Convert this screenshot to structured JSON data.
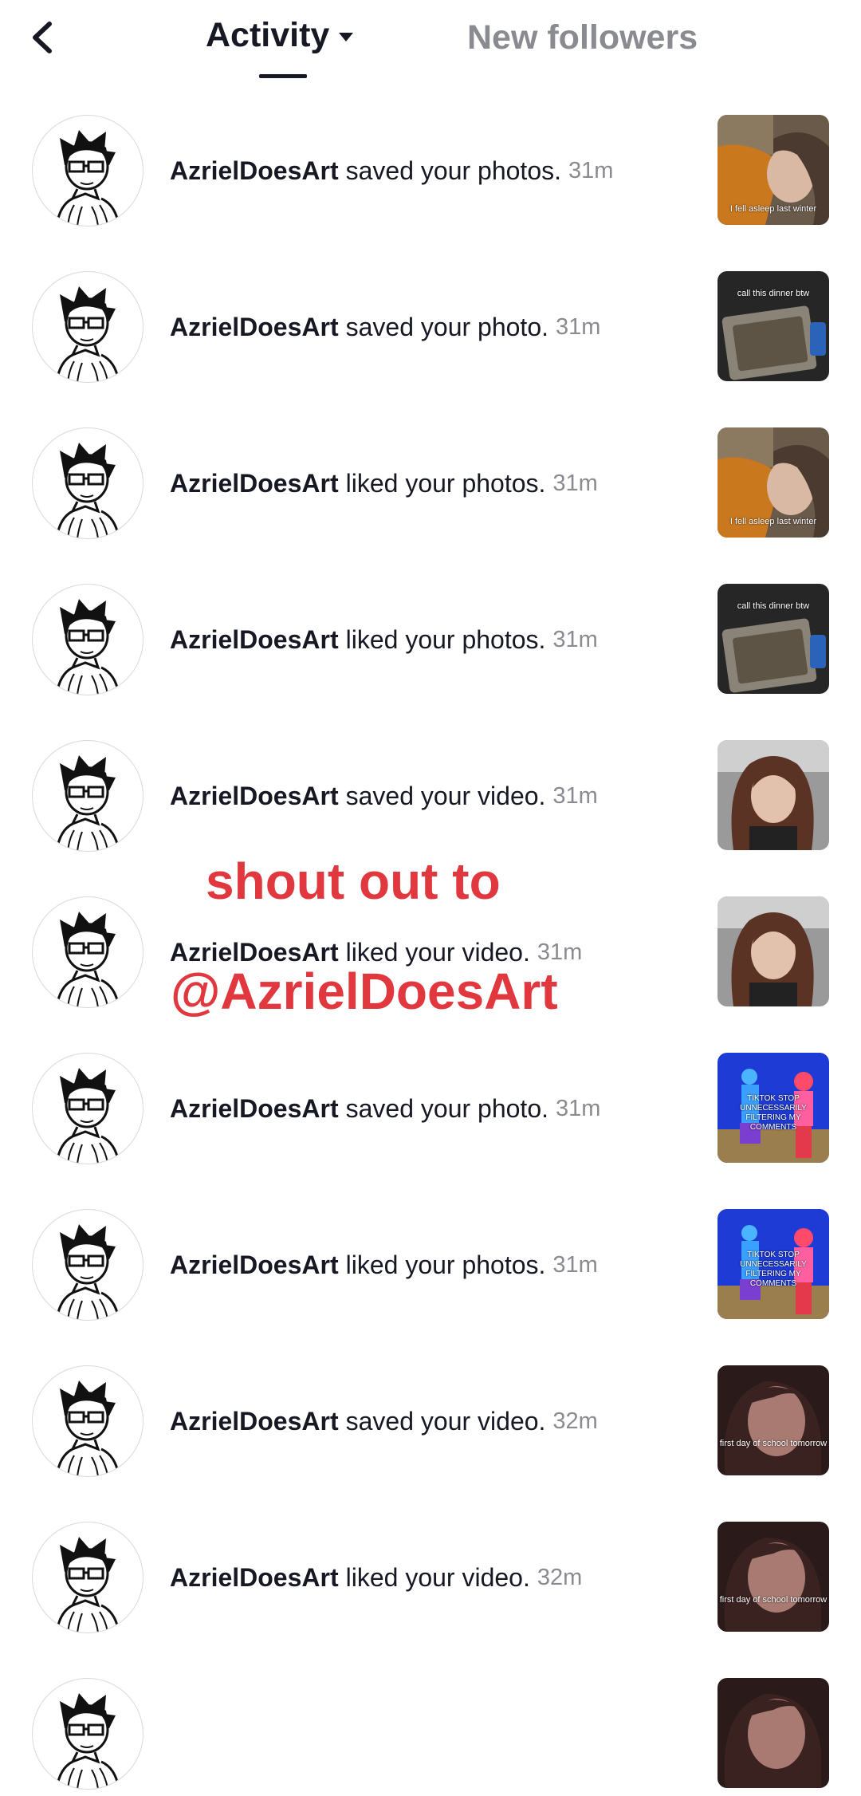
{
  "header": {
    "tabs": [
      {
        "label": "Activity",
        "active": true
      },
      {
        "label": "New followers",
        "active": false
      }
    ]
  },
  "overlay": {
    "line1": "shout out to",
    "line2": "@AzrielDoesArt",
    "color": "#e0383e"
  },
  "notifications": [
    {
      "user": "AzrielDoesArt",
      "action": "saved your photos.",
      "time": "31m",
      "thumb": "sleep",
      "caption": "I fell asleep last winter"
    },
    {
      "user": "AzrielDoesArt",
      "action": "saved your photo.",
      "time": "31m",
      "thumb": "dinner",
      "caption": "call this dinner btw"
    },
    {
      "user": "AzrielDoesArt",
      "action": "liked your photos.",
      "time": "31m",
      "thumb": "sleep",
      "caption": "I fell asleep last winter"
    },
    {
      "user": "AzrielDoesArt",
      "action": "liked your photos.",
      "time": "31m",
      "thumb": "dinner",
      "caption": "call this dinner btw"
    },
    {
      "user": "AzrielDoesArt",
      "action": "saved your video.",
      "time": "31m",
      "thumb": "car",
      "caption": ""
    },
    {
      "user": "AzrielDoesArt",
      "action": "liked your video.",
      "time": "31m",
      "thumb": "car",
      "caption": ""
    },
    {
      "user": "AzrielDoesArt",
      "action": "saved your photo.",
      "time": "31m",
      "thumb": "dance",
      "caption": "TIKTOK STOP UNNECESSARILY FILTERING MY COMMENTS"
    },
    {
      "user": "AzrielDoesArt",
      "action": "liked your photos.",
      "time": "31m",
      "thumb": "dance",
      "caption": "TIKTOK STOP UNNECESSARILY FILTERING MY COMMENTS"
    },
    {
      "user": "AzrielDoesArt",
      "action": "saved your video.",
      "time": "32m",
      "thumb": "school",
      "caption": "first day of school tomorrow"
    },
    {
      "user": "AzrielDoesArt",
      "action": "liked your video.",
      "time": "32m",
      "thumb": "school",
      "caption": "first day of school tomorrow"
    }
  ],
  "partial_row": {
    "thumb": "school"
  }
}
